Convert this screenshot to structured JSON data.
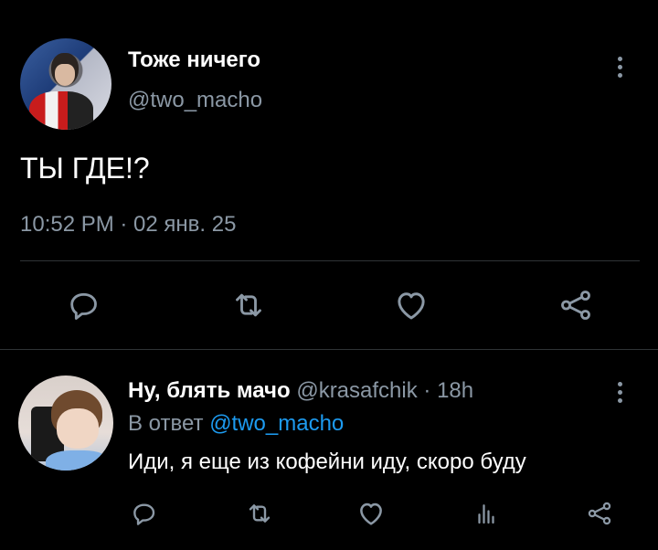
{
  "tweet": {
    "display_name": "Тоже ничего",
    "handle": "@two_macho",
    "text": "ТЫ ГДЕ!?",
    "timestamp": "10:52 PM · 02 янв. 25",
    "avatar_icon": "profile-photo-avatar",
    "actions": [
      "reply-icon",
      "retweet-icon",
      "like-icon",
      "share-icon"
    ]
  },
  "reply": {
    "display_name": "Ну, блять мачо",
    "handle": "@krasafchik",
    "separator": "·",
    "time": "18h",
    "in_reply_prefix": "В ответ",
    "in_reply_handle": "@two_macho",
    "text": "Иди, я еще из кофейни иду, скоро буду",
    "avatar_icon": "profile-photo-avatar",
    "actions": [
      "reply-icon",
      "retweet-icon",
      "like-icon",
      "analytics-icon",
      "share-icon"
    ]
  },
  "colors": {
    "background": "#000000",
    "text": "#ffffff",
    "muted": "#8b98a5",
    "link": "#1d9bf0",
    "divider": "#2f3336"
  }
}
